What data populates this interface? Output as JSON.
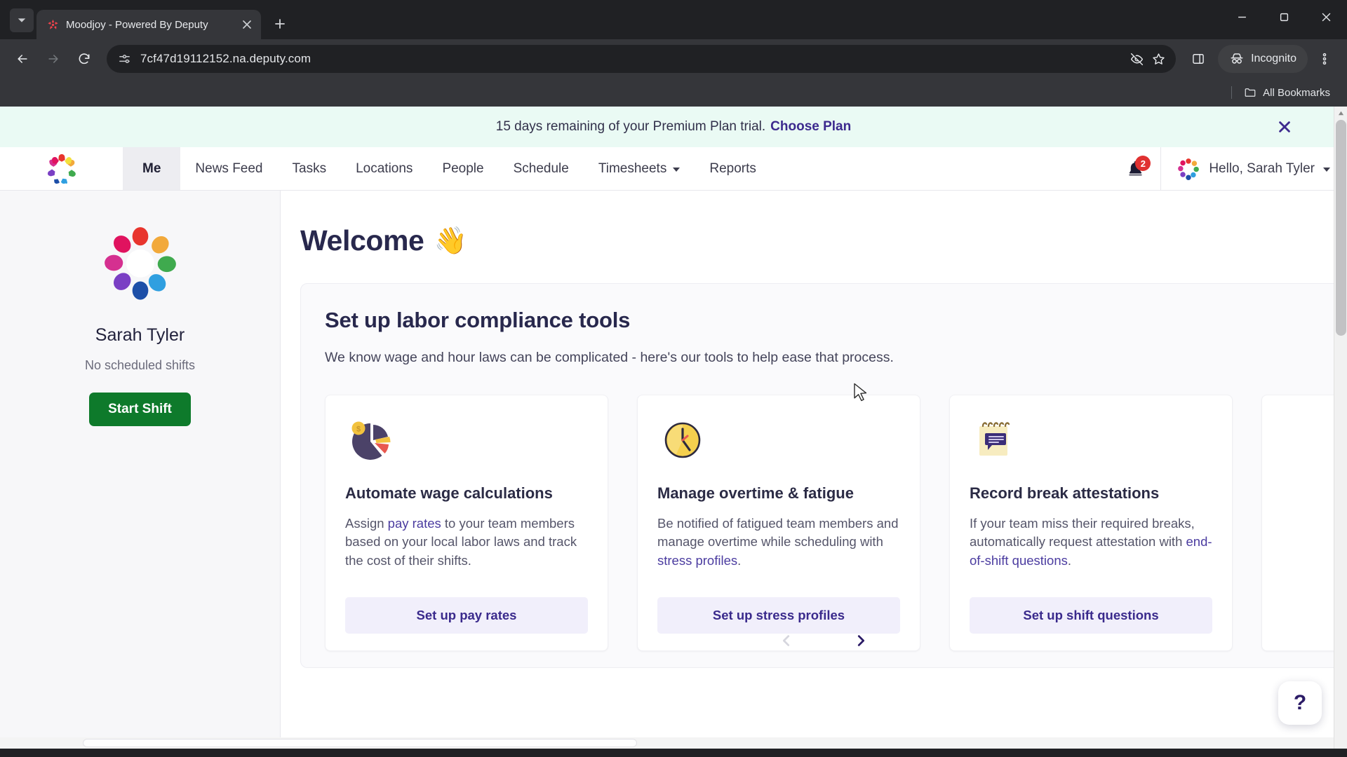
{
  "browser": {
    "tab": {
      "title": "Moodjoy - Powered By Deputy",
      "favicon": "deputy-logo-icon"
    },
    "new_tab_label": "+",
    "url": "7cf47d19112152.na.deputy.com",
    "profile_label": "Incognito",
    "bookmarks_label": "All Bookmarks",
    "icons": {
      "tab_list": "tab-search-icon",
      "back": "back-arrow-icon",
      "forward": "forward-arrow-icon",
      "reload": "reload-icon",
      "site_info": "site-settings-icon",
      "tracking": "eye-slash-icon",
      "bookmark": "star-icon",
      "side_panel": "side-panel-icon",
      "menu": "three-dot-menu-icon",
      "minimize": "minimize-icon",
      "maximize": "maximize-icon",
      "close": "window-close-icon"
    }
  },
  "trial": {
    "message": "15 days remaining of your Premium Plan trial.",
    "cta": "Choose Plan",
    "close_icon": "close-icon",
    "bg": "#eafaf4",
    "link_color": "#3d2a8e"
  },
  "nav": {
    "logo": "deputy-star-logo",
    "items": [
      {
        "label": "Me",
        "active": true,
        "dropdown": false
      },
      {
        "label": "News Feed",
        "active": false,
        "dropdown": false
      },
      {
        "label": "Tasks",
        "active": false,
        "dropdown": false
      },
      {
        "label": "Locations",
        "active": false,
        "dropdown": false
      },
      {
        "label": "People",
        "active": false,
        "dropdown": false
      },
      {
        "label": "Schedule",
        "active": false,
        "dropdown": false
      },
      {
        "label": "Timesheets",
        "active": false,
        "dropdown": true
      },
      {
        "label": "Reports",
        "active": false,
        "dropdown": false
      }
    ],
    "notifications": {
      "icon": "bell-icon",
      "count": "2",
      "badge_color": "#e03131"
    },
    "user": {
      "greeting": "Hello, Sarah Tyler",
      "avatar": "user-avatar-logo"
    }
  },
  "sidebar": {
    "avatar": "profile-avatar-logo",
    "name": "Sarah Tyler",
    "shift_status": "No scheduled shifts",
    "start_shift_label": "Start Shift",
    "start_shift_color": "#0e7a2b"
  },
  "main": {
    "welcome_title": "Welcome",
    "welcome_emoji": "👋",
    "panel": {
      "title": "Set up labor compliance tools",
      "subtitle": "We know wage and hour laws can be complicated - here's our tools to help ease that process.",
      "collapse_icon": "chevron-up-icon",
      "cards": [
        {
          "icon": "pie-chart-coin-icon",
          "title": "Automate wage calculations",
          "desc_1": "Assign ",
          "desc_link": "pay rates",
          "desc_2": " to your team members based on your local labor laws and track the cost of their shifts.",
          "cta": "Set up pay rates"
        },
        {
          "icon": "clock-icon",
          "title": "Manage overtime & fatigue",
          "desc_1": "Be notified of fatigued team members and manage overtime while scheduling with ",
          "desc_link": "stress profiles",
          "desc_2": ".",
          "cta": "Set up stress profiles"
        },
        {
          "icon": "notepad-speech-icon",
          "title": "Record break attestations",
          "desc_1": "If your team miss their required breaks, automatically request attestation with ",
          "desc_link": "end-of-shift questions",
          "desc_2": ".",
          "cta": "Set up shift questions"
        }
      ],
      "carousel": {
        "prev_icon": "chevron-left-icon",
        "next_icon": "chevron-right-icon",
        "prev_enabled": false,
        "next_enabled": true
      }
    },
    "help_button": "?"
  }
}
